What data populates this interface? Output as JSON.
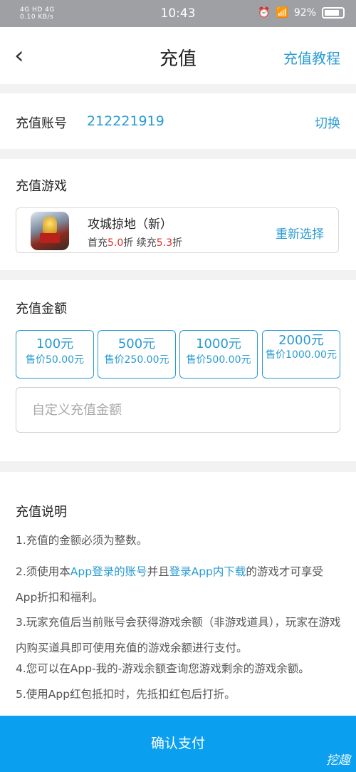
{
  "status": {
    "network": "4G HD 4G",
    "speed": "0.10 KB/s",
    "time": "10:43",
    "battery": "92%"
  },
  "nav": {
    "back_glyph": "‹",
    "title": "充值",
    "right": "充值教程"
  },
  "account": {
    "label": "充值账号",
    "value": "212221919",
    "switch": "切换"
  },
  "game": {
    "section_title": "充值游戏",
    "name": "攻城掠地（新）",
    "first_label": "首充",
    "first_discount": "5.0",
    "first_unit": "折",
    "renew_label": " 续充",
    "renew_discount": "5.3",
    "renew_unit": "折",
    "reselect": "重新选择"
  },
  "amount": {
    "section_title": "充值金额",
    "options": [
      {
        "amount": "100元",
        "price": "售价50.00元"
      },
      {
        "amount": "500元",
        "price": "售价250.00元"
      },
      {
        "amount": "1000元",
        "price": "售价500.00元"
      },
      {
        "amount": "2000元",
        "price": "售价1000.00元"
      }
    ],
    "custom_placeholder": "自定义充值金额"
  },
  "notes": {
    "title": "充值说明",
    "n1": "1.充值的金额必须为整数。",
    "n2_a": "2.须使用本",
    "n2_link1": "App登录的账号",
    "n2_b": "并且",
    "n2_link2": "登录App内下载",
    "n2_c": "的游戏才可享受App折扣和福利。",
    "n3": "3.玩家充值后当前账号会获得游戏余额（非游戏道具），玩家在游戏内购买道具即可使用充值的游戏余额进行支付。",
    "n4": "4.您可以在App-我的-游戏余额查询您游戏剩余的游戏余额。",
    "n5": "5.使用App红包抵扣时，先抵扣红包后打折。"
  },
  "pay_button": "确认支付",
  "watermark": "挖趣"
}
